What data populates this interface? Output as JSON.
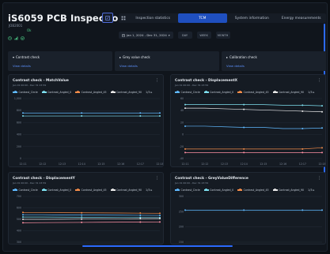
{
  "header": {
    "title": "iS6059 PCB Inspection",
    "subtitle": "JOB2001",
    "status_ok": "Ok"
  },
  "tabs": [
    {
      "label": "Inspection statistics",
      "active": false
    },
    {
      "label": "TCM",
      "active": true
    },
    {
      "label": "System information",
      "active": false
    },
    {
      "label": "Energy measurements",
      "active": false
    }
  ],
  "toolbar": {
    "date_range": "Jan 1, 2024 - Dec 31, 2024",
    "range_buttons": [
      "DAY",
      "WEEK",
      "MONTH"
    ]
  },
  "checks": [
    {
      "name": "Contrast check",
      "link": "View details"
    },
    {
      "name": "Grey value check",
      "link": "View details"
    },
    {
      "name": "Calibration check",
      "link": "View details"
    }
  ],
  "legend_labels": [
    "Contrast_Circle",
    "Contrast_Angled_0",
    "Contrast_Angled_45",
    "Contrast_Angled_90",
    "1/3"
  ],
  "series_colors": [
    "#60b9ff",
    "#7ee0f0",
    "#f28c4a",
    "#e8e8e8",
    "#ff8fa3",
    "#b4ff8f"
  ],
  "panels": [
    {
      "title": "Contrast check - MatchValue",
      "subtitle": "Jan 01 00:00 - Dec 31 23:59",
      "y_ticks": [
        "1,000",
        "800",
        "600",
        "400",
        "200",
        "0"
      ],
      "x_ticks": [
        "12:11",
        "12:12",
        "12:13",
        "12:14",
        "12:15",
        "12:16",
        "12:17",
        "12:18"
      ]
    },
    {
      "title": "Contrast check - DisplacementX",
      "subtitle": "Jan 01 00:00 - Dec 31 23:59",
      "y_ticks": [
        "60",
        "40",
        "20",
        "0",
        "-20",
        "-40"
      ],
      "x_ticks": [
        "12:11",
        "12:12",
        "12:13",
        "12:14",
        "12:15",
        "12:16",
        "12:17",
        "12:18"
      ]
    },
    {
      "title": "Contrast check - DisplacementY",
      "subtitle": "Jan 01 00:00 - Dec 31 23:59",
      "y_ticks": [
        "700",
        "600",
        "500",
        "400",
        "300"
      ],
      "x_ticks": []
    },
    {
      "title": "Contrast check - GreyValueDifference",
      "subtitle": "Jan 01 00:00 - Dec 31 23:59",
      "y_ticks": [
        "300",
        "250",
        "200",
        "150"
      ],
      "x_ticks": []
    }
  ],
  "chart_data": [
    {
      "type": "line",
      "title": "Contrast check - MatchValue",
      "x": [
        "12:11",
        "12:12",
        "12:13",
        "12:14",
        "12:15",
        "12:16",
        "12:17",
        "12:18"
      ],
      "ylim": [
        0,
        1000
      ],
      "series": [
        {
          "name": "Contrast_Circle",
          "values": [
            760,
            760,
            760,
            760,
            760,
            760,
            760,
            760
          ]
        },
        {
          "name": "Contrast_Angled_0",
          "values": [
            710,
            710,
            710,
            710,
            710,
            710,
            710,
            710
          ]
        }
      ]
    },
    {
      "type": "line",
      "title": "Contrast check - DisplacementX",
      "x": [
        "12:11",
        "12:12",
        "12:13",
        "12:14",
        "12:15",
        "12:16",
        "12:17",
        "12:18"
      ],
      "ylim": [
        -40,
        60
      ],
      "series": [
        {
          "name": "Contrast_Circle",
          "values": [
            14,
            14,
            13,
            12,
            12,
            10,
            10,
            11
          ]
        },
        {
          "name": "Contrast_Angled_0",
          "values": [
            50,
            50,
            50,
            50,
            50,
            49,
            49,
            48
          ]
        },
        {
          "name": "Contrast_Angled_45",
          "values": [
            -24,
            -24,
            -24,
            -24,
            -24,
            -24,
            -24,
            -22
          ]
        },
        {
          "name": "Contrast_Angled_90",
          "values": [
            44,
            44,
            43,
            42,
            41,
            40,
            39,
            38
          ]
        },
        {
          "name": "1/3",
          "values": [
            -30,
            -30,
            -30,
            -30,
            -30,
            -30,
            -30,
            -30
          ]
        }
      ]
    },
    {
      "type": "line",
      "title": "Contrast check - DisplacementY",
      "x": [
        "12:11",
        "12:12",
        "12:13",
        "12:14",
        "12:15",
        "12:16",
        "12:17",
        "12:18"
      ],
      "ylim": [
        300,
        700
      ],
      "series": [
        {
          "name": "Contrast_Circle",
          "values": [
            540,
            540,
            538,
            537,
            537,
            536,
            535,
            534
          ]
        },
        {
          "name": "Contrast_Angled_0",
          "values": [
            520,
            520,
            519,
            518,
            517,
            516,
            516,
            515
          ]
        },
        {
          "name": "Contrast_Angled_45",
          "values": [
            560,
            559,
            558,
            557,
            556,
            555,
            554,
            553
          ]
        },
        {
          "name": "Contrast_Angled_90",
          "values": [
            500,
            500,
            501,
            502,
            503,
            504,
            505,
            506
          ]
        },
        {
          "name": "1/3",
          "values": [
            470,
            471,
            472,
            473,
            474,
            475,
            476,
            477
          ]
        }
      ]
    },
    {
      "type": "line",
      "title": "Contrast check - GreyValueDifference",
      "x": [
        "12:11",
        "12:12",
        "12:13",
        "12:14",
        "12:15",
        "12:16",
        "12:17",
        "12:18"
      ],
      "ylim": [
        150,
        300
      ],
      "series": [
        {
          "name": "Contrast_Circle",
          "values": [
            255,
            255,
            255,
            255,
            255,
            255,
            255,
            255
          ]
        }
      ]
    }
  ]
}
